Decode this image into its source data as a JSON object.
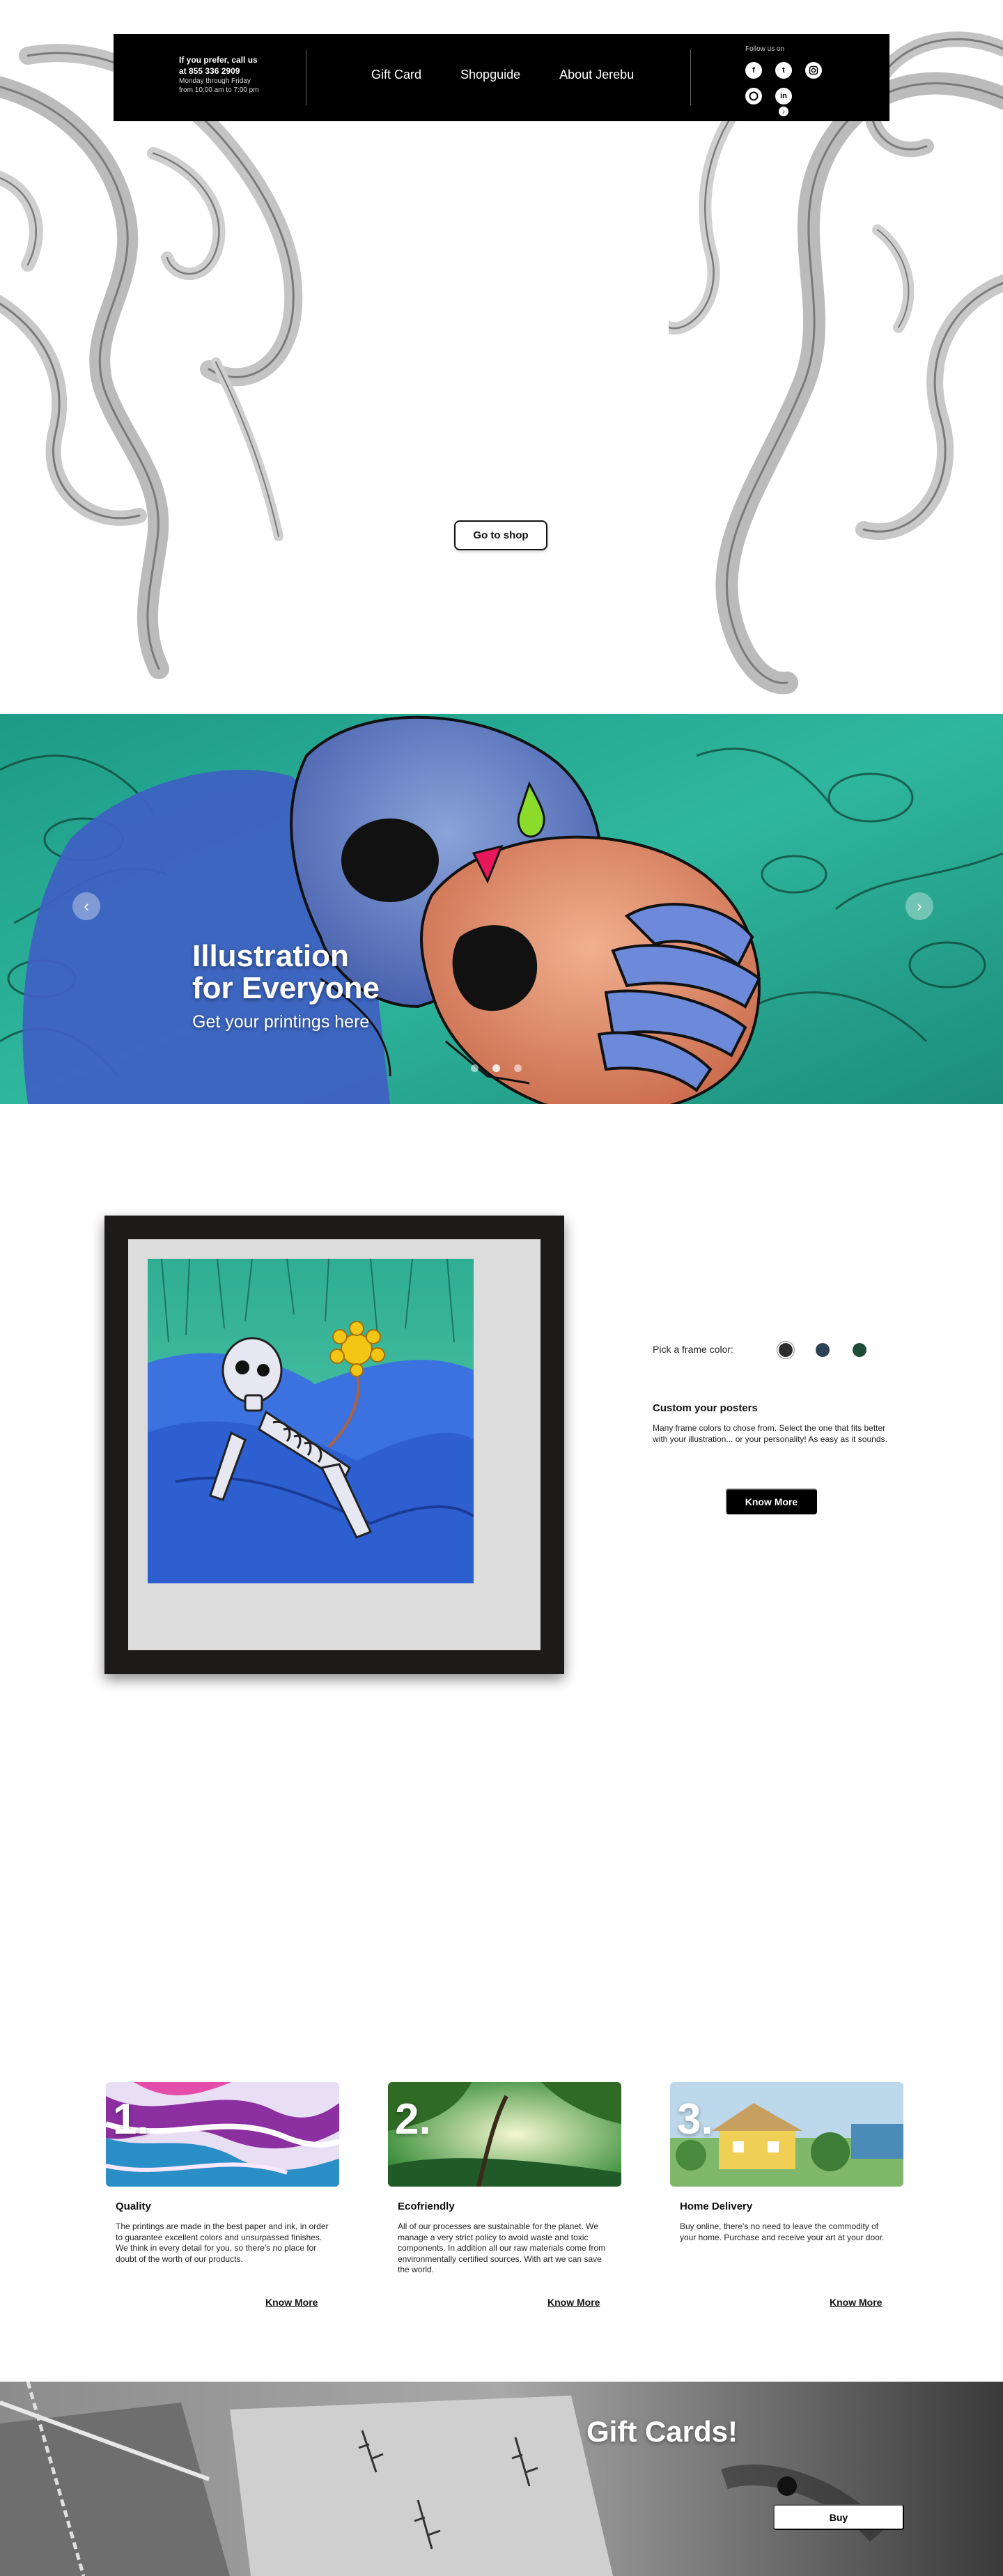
{
  "header": {
    "contact_line1": "If you prefer, call us",
    "contact_line2": "at 855 336 2909",
    "contact_hours1": "Monday through Friday",
    "contact_hours2": "from 10:00 am to 7:00 pm",
    "nav": [
      "Gift Card",
      "Shopguide",
      "About Jerebu"
    ],
    "follow_label": "Follow us on",
    "social_icons": [
      "facebook-icon",
      "twitter-icon",
      "instagram-icon",
      "pinterest-icon",
      "linkedin-icon",
      "tiktok-icon"
    ]
  },
  "hero": {
    "shop_button": "Go to shop"
  },
  "banner": {
    "title_line1": "Illustration",
    "title_line2": "for Everyone",
    "subtitle": "Get your printings here",
    "slides": 3,
    "active_slide": 2
  },
  "frame": {
    "pick_label": "Pick a frame color:",
    "colors": [
      "#2e2e2e",
      "#2f4257",
      "#1f4d3a"
    ],
    "title": "Custom your posters",
    "description": "Many frame colors to chose from. Select the one that fits better with your illustration... or your personality! As easy as it sounds.",
    "button": "Know More"
  },
  "features": [
    {
      "num": "1.",
      "title": "Quality",
      "text": "The printings are made in the best paper and ink, in order to guarantee excellent colors and unsurpassed finishes.  We think in every detail for you, so there's no place for doubt of the worth of our products.",
      "link": "Know More"
    },
    {
      "num": "2.",
      "title": "Ecofriendly",
      "text": "All of our processes are sustainable for the planet. We manage a very strict policy to avoid waste and toxic components. In addition all our raw materials come from environmentally certified sources. With art we can save the world.",
      "link": "Know More"
    },
    {
      "num": "3.",
      "title": "Home Delivery",
      "text": "Buy online, there's no need to leave the commodity of your home. Purchase and receive your art at your door.",
      "link": "Know More"
    }
  ],
  "gift": {
    "title": "Gift Cards!",
    "button": "Buy"
  }
}
